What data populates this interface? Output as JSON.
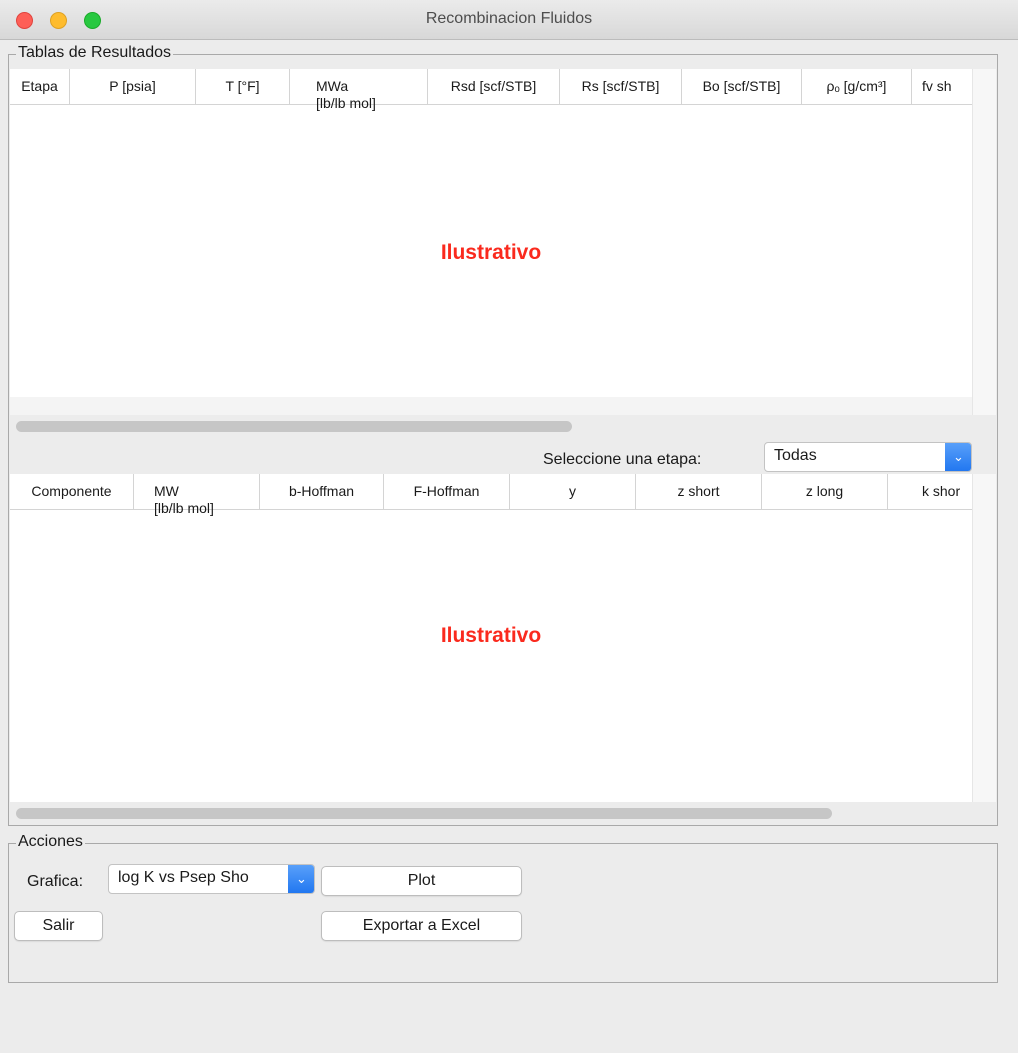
{
  "window": {
    "title": "Recombinacion Fluidos"
  },
  "results_group": {
    "label": "Tablas de Resultados"
  },
  "table1": {
    "columns": [
      {
        "label": "Etapa",
        "sub": ""
      },
      {
        "label": "P [psia]",
        "sub": ""
      },
      {
        "label": "T [°F]",
        "sub": ""
      },
      {
        "label": "MWa",
        "sub": "[lb/lb mol]"
      },
      {
        "label": "Rsd [scf/STB]",
        "sub": ""
      },
      {
        "label": "Rs [scf/STB]",
        "sub": ""
      },
      {
        "label": "Bo [scf/STB]",
        "sub": ""
      },
      {
        "label": "ρₒ [g/cm³]",
        "sub": ""
      },
      {
        "label": "fv sh",
        "sub": ""
      }
    ],
    "placeholder": "Ilustrativo"
  },
  "stage_select": {
    "label": "Seleccione una etapa:",
    "value": "Todas"
  },
  "table2": {
    "columns": [
      {
        "label": "Componente",
        "sub": ""
      },
      {
        "label": "MW",
        "sub": "[lb/lb mol]"
      },
      {
        "label": "b-Hoffman",
        "sub": ""
      },
      {
        "label": "F-Hoffman",
        "sub": ""
      },
      {
        "label": "y",
        "sub": ""
      },
      {
        "label": "z short",
        "sub": ""
      },
      {
        "label": "z long",
        "sub": ""
      },
      {
        "label": "k shor",
        "sub": ""
      }
    ],
    "placeholder": "Ilustrativo"
  },
  "actions_group": {
    "label": "Acciones"
  },
  "graph_select": {
    "label": "Grafica:",
    "value": "log K vs Psep Sho"
  },
  "buttons": {
    "plot": "Plot",
    "exit": "Salir",
    "export": "Exportar a Excel"
  },
  "colors": {
    "accent": "#2a7cf4",
    "placeholder_text": "#fa2a1e"
  }
}
